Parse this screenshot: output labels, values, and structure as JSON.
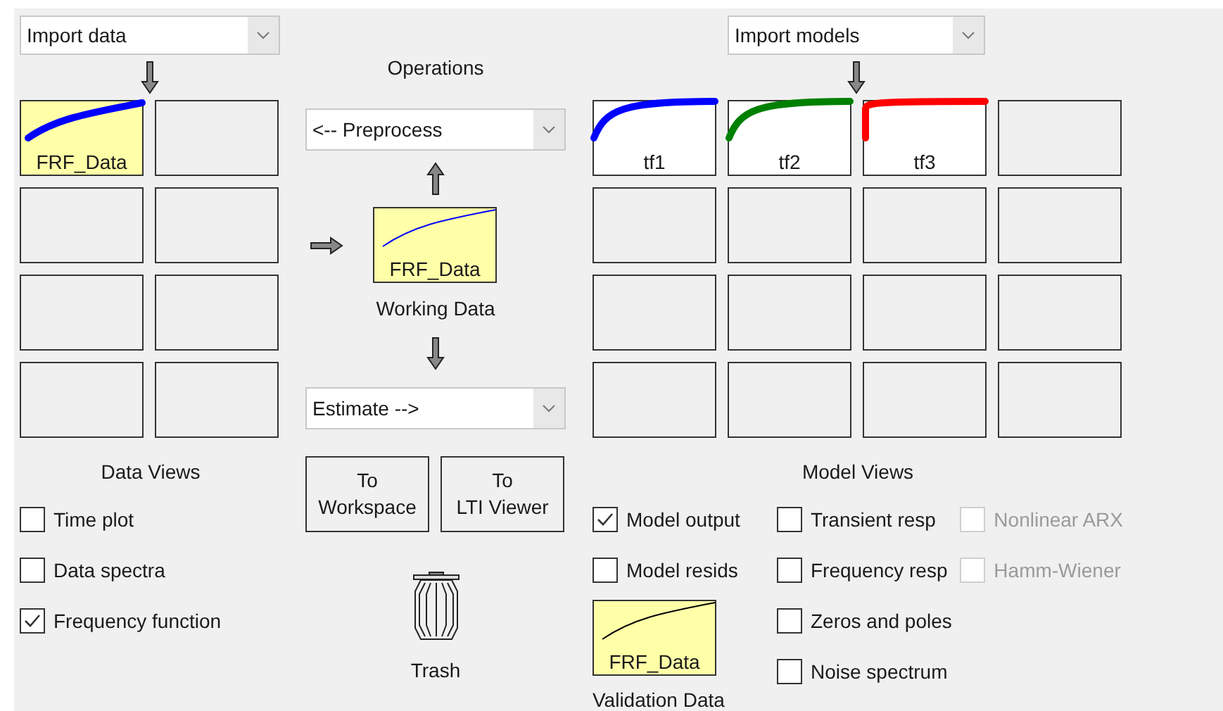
{
  "data_panel": {
    "import_dropdown": {
      "value": "Import data"
    },
    "tiles": [
      {
        "kind": "data",
        "label": "FRF_Data",
        "color": "#0000ff"
      },
      {
        "kind": "empty"
      },
      {
        "kind": "empty"
      },
      {
        "kind": "empty"
      },
      {
        "kind": "empty"
      },
      {
        "kind": "empty"
      },
      {
        "kind": "empty"
      },
      {
        "kind": "empty"
      }
    ],
    "views_title": "Data Views",
    "views": [
      {
        "label": "Time plot",
        "checked": false,
        "disabled": false
      },
      {
        "label": "Data spectra",
        "checked": false,
        "disabled": false
      },
      {
        "label": "Frequency function",
        "checked": true,
        "disabled": false
      }
    ]
  },
  "operations": {
    "title": "Operations",
    "preprocess_dropdown": {
      "value": "<-- Preprocess"
    },
    "working_data": {
      "label": "FRF_Data",
      "color": "#0000ff",
      "caption": "Working Data"
    },
    "estimate_dropdown": {
      "value": "Estimate -->"
    },
    "buttons": [
      "To\nWorkspace",
      "To\nLTI Viewer"
    ],
    "trash": {
      "label": "Trash"
    }
  },
  "model_panel": {
    "import_dropdown": {
      "value": "Import models"
    },
    "tiles": [
      {
        "kind": "model",
        "label": "tf1",
        "color": "#0000ff"
      },
      {
        "kind": "model",
        "label": "tf2",
        "color": "#008000"
      },
      {
        "kind": "step",
        "label": "tf3",
        "color": "#ff0000"
      },
      {
        "kind": "empty"
      },
      {
        "kind": "empty"
      },
      {
        "kind": "empty"
      },
      {
        "kind": "empty"
      },
      {
        "kind": "empty"
      },
      {
        "kind": "empty"
      },
      {
        "kind": "empty"
      },
      {
        "kind": "empty"
      },
      {
        "kind": "empty"
      },
      {
        "kind": "empty"
      },
      {
        "kind": "empty"
      },
      {
        "kind": "empty"
      },
      {
        "kind": "empty"
      }
    ],
    "views_title": "Model Views",
    "view_columns": [
      [
        {
          "label": "Model output",
          "checked": true,
          "disabled": false
        },
        {
          "label": "Model resids",
          "checked": false,
          "disabled": false
        }
      ],
      [
        {
          "label": "Transient resp",
          "checked": false,
          "disabled": false
        },
        {
          "label": "Frequency resp",
          "checked": false,
          "disabled": false
        },
        {
          "label": "Zeros and poles",
          "checked": false,
          "disabled": false
        },
        {
          "label": "Noise spectrum",
          "checked": false,
          "disabled": false
        }
      ],
      [
        {
          "label": "Nonlinear ARX",
          "checked": false,
          "disabled": true
        },
        {
          "label": "Hamm-Wiener",
          "checked": false,
          "disabled": true
        }
      ]
    ],
    "validation_data": {
      "label": "FRF_Data",
      "color": "#000000",
      "caption": "Validation Data"
    }
  }
}
